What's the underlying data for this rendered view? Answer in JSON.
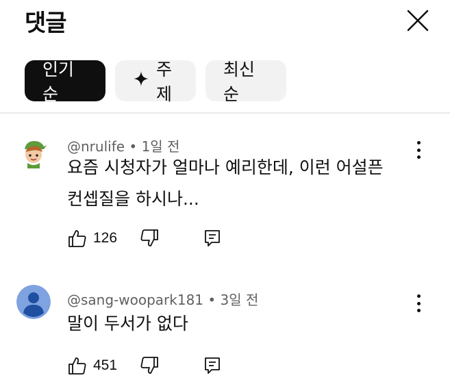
{
  "header": {
    "title": "댓글",
    "close_icon": "close-icon"
  },
  "sort_chips": [
    {
      "label": "인기순",
      "active": true
    },
    {
      "label": "주제",
      "icon": "sparkle-icon",
      "active": false
    },
    {
      "label": "최신순",
      "active": false
    }
  ],
  "comments": [
    {
      "author": "@nrulife",
      "separator": "•",
      "time": "1일 전",
      "text_lines": [
        "요즘 시청자가 얼마나 예리한데, 이런 어설픈",
        "컨셉질을 하시나..."
      ],
      "likes": "126",
      "avatar": "cartoon-avatar-icon"
    },
    {
      "author": "@sang-woopark181",
      "separator": "•",
      "time": "3일 전",
      "text_lines": [
        "말이 두서가 없다"
      ],
      "likes": "451",
      "avatar": "default-person-avatar-icon"
    }
  ],
  "colors": {
    "active_chip": "#0f0f0f",
    "chip_bg": "#f2f2f2",
    "meta_text": "#606060",
    "avatar_blue": "#7fa3e0"
  }
}
